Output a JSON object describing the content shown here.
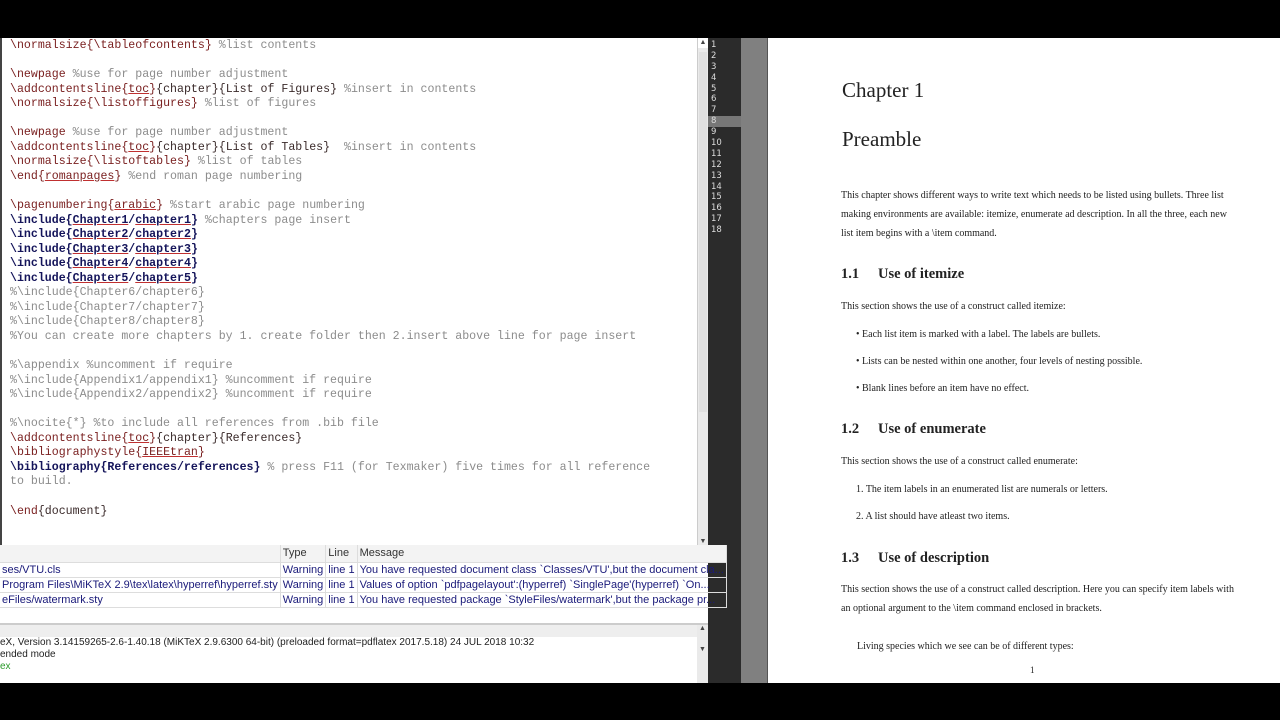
{
  "editor": {
    "lines": [
      [
        [
          "cmd",
          "\\normalsize"
        ],
        [
          "br",
          "{"
        ],
        [
          "cmd",
          "\\tableofcontents"
        ],
        [
          "br",
          "}"
        ],
        [
          "com",
          " %list contents"
        ]
      ],
      [],
      [
        [
          "cmd",
          "\\newpage"
        ],
        [
          "com",
          " %use for page number adjustment"
        ]
      ],
      [
        [
          "cmd",
          "\\addcontentsline"
        ],
        [
          "br",
          "{"
        ],
        [
          "ul",
          "toc"
        ],
        [
          "br",
          "}"
        ],
        [
          "txt",
          "{chapter}{List of Figures}"
        ],
        [
          "com",
          " %insert in contents"
        ]
      ],
      [
        [
          "cmd",
          "\\normalsize"
        ],
        [
          "br",
          "{"
        ],
        [
          "cmd",
          "\\listoffigures"
        ],
        [
          "br",
          "}"
        ],
        [
          "com",
          " %list of figures"
        ]
      ],
      [],
      [
        [
          "cmd",
          "\\newpage"
        ],
        [
          "com",
          " %use for page number adjustment"
        ]
      ],
      [
        [
          "cmd",
          "\\addcontentsline"
        ],
        [
          "br",
          "{"
        ],
        [
          "ul",
          "toc"
        ],
        [
          "br",
          "}"
        ],
        [
          "txt",
          "{chapter}{List of Tables}"
        ],
        [
          "com",
          "  %insert in contents"
        ]
      ],
      [
        [
          "cmd",
          "\\normalsize"
        ],
        [
          "br",
          "{"
        ],
        [
          "cmd",
          "\\listoftables"
        ],
        [
          "br",
          "}"
        ],
        [
          "com",
          " %list of tables"
        ]
      ],
      [
        [
          "cmd",
          "\\end"
        ],
        [
          "br",
          "{"
        ],
        [
          "ul",
          "romanpages"
        ],
        [
          "br",
          "}"
        ],
        [
          "com",
          " %end roman page numbering"
        ]
      ],
      [],
      [
        [
          "cmd",
          "\\pagenumbering"
        ],
        [
          "br",
          "{"
        ],
        [
          "ul",
          "arabic"
        ],
        [
          "br",
          "}"
        ],
        [
          "com",
          " %start arabic page numbering"
        ]
      ],
      [
        [
          "inc",
          "\\include{"
        ],
        [
          "link",
          "Chapter1"
        ],
        [
          "inc",
          "/"
        ],
        [
          "link",
          "chapter1"
        ],
        [
          "inc",
          "}"
        ],
        [
          "com",
          " %chapters page insert"
        ]
      ],
      [
        [
          "inc",
          "\\include{"
        ],
        [
          "link",
          "Chapter2"
        ],
        [
          "inc",
          "/"
        ],
        [
          "link",
          "chapter2"
        ],
        [
          "inc",
          "}"
        ]
      ],
      [
        [
          "inc",
          "\\include{"
        ],
        [
          "link",
          "Chapter3"
        ],
        [
          "inc",
          "/"
        ],
        [
          "link",
          "chapter3"
        ],
        [
          "inc",
          "}"
        ]
      ],
      [
        [
          "inc",
          "\\include{"
        ],
        [
          "link",
          "Chapter4"
        ],
        [
          "inc",
          "/"
        ],
        [
          "link",
          "chapter4"
        ],
        [
          "inc",
          "}"
        ]
      ],
      [
        [
          "inc",
          "\\include{"
        ],
        [
          "link",
          "Chapter5"
        ],
        [
          "inc",
          "/"
        ],
        [
          "link",
          "chapter5"
        ],
        [
          "inc",
          "}"
        ]
      ],
      [
        [
          "com",
          "%\\include{Chapter6/chapter6}"
        ]
      ],
      [
        [
          "com",
          "%\\include{Chapter7/chapter7}"
        ]
      ],
      [
        [
          "com",
          "%\\include{Chapter8/chapter8}"
        ]
      ],
      [
        [
          "com",
          "%You can create more chapters by 1. create folder then 2.insert above line for page insert"
        ]
      ],
      [],
      [
        [
          "com",
          "%\\appendix %uncomment if require"
        ]
      ],
      [
        [
          "com",
          "%\\include{Appendix1/appendix1} %uncomment if require"
        ]
      ],
      [
        [
          "com",
          "%\\include{Appendix2/appendix2} %uncomment if require"
        ]
      ],
      [],
      [
        [
          "com",
          "%\\nocite{*} %to include all references from .bib file"
        ]
      ],
      [
        [
          "cmd",
          "\\addcontentsline"
        ],
        [
          "br",
          "{"
        ],
        [
          "ul",
          "toc"
        ],
        [
          "br",
          "}"
        ],
        [
          "txt",
          "{chapter}{References}"
        ]
      ],
      [
        [
          "cmd",
          "\\bibliographystyle"
        ],
        [
          "br",
          "{"
        ],
        [
          "ul",
          "IEEEtran"
        ],
        [
          "br",
          "}"
        ]
      ],
      [
        [
          "inc",
          "\\bibliography{References/references}"
        ],
        [
          "com",
          " % press F11 (for Texmaker) five times for all reference"
        ]
      ],
      [
        [
          "com",
          "to build."
        ]
      ],
      [],
      [
        [
          "cmd",
          "\\end"
        ],
        [
          "txt",
          "{document}"
        ]
      ]
    ]
  },
  "structure_lines": [
    "1",
    "2",
    "3",
    "4",
    "5",
    "6",
    "7",
    "8",
    "9",
    "10",
    "11",
    "12",
    "13",
    "14",
    "15",
    "16",
    "17",
    "18"
  ],
  "current_line": "8",
  "messages": {
    "headers": [
      "",
      "Type",
      "Line",
      "Message"
    ],
    "rows": [
      [
        "ses/VTU.cls",
        "Warning",
        "line 1",
        "You have requested document class `Classes/VTU',but the document cla..."
      ],
      [
        "Program Files\\MiKTeX 2.9\\tex\\latex\\hyperref\\hyperref.sty",
        "Warning",
        "line 1",
        "Values of option `pdfpagelayout':(hyperref)  `SinglePage'(hyperref)  `On..."
      ],
      [
        "eFiles/watermark.sty",
        "Warning",
        "line 1",
        "You have requested package `StyleFiles/watermark',but the package pr..."
      ]
    ]
  },
  "log": [
    "eX, Version 3.14159265-2.6-1.40.18 (MiKTeX 2.9.6300 64-bit) (preloaded format=pdflatex 2017.5.18) 24 JUL 2018 10:32",
    "ended mode",
    "ex"
  ],
  "pdf": {
    "chapter": "Chapter 1",
    "title": "Preamble",
    "intro": "This chapter shows different ways to write text which needs to be listed using bullets. Three list making environments are available: itemize, enumerate ad description. In all the three, each new list item begins with a \\item command.",
    "s1": {
      "num": "1.1",
      "title": "Use of itemize",
      "text": "This section shows the use of a construct called itemize:",
      "items": [
        "Each list item is marked with a label. The labels are bullets.",
        "Lists can be nested within one another, four levels of nesting possible.",
        "Blank lines before an item have no effect."
      ]
    },
    "s2": {
      "num": "1.2",
      "title": "Use of enumerate",
      "text": "This section shows the use of a construct called enumerate:",
      "items": [
        "1. The item labels in an enumerated list are numerals or letters.",
        "2. A list should have atleast two items."
      ]
    },
    "s3": {
      "num": "1.3",
      "title": "Use of description",
      "text": "This section shows the use of a construct called description. Here you can specify item labels with an optional argument to the \\item command enclosed in brackets.",
      "extra": "Living species which we see can be of different types:"
    },
    "page_number": "1"
  }
}
